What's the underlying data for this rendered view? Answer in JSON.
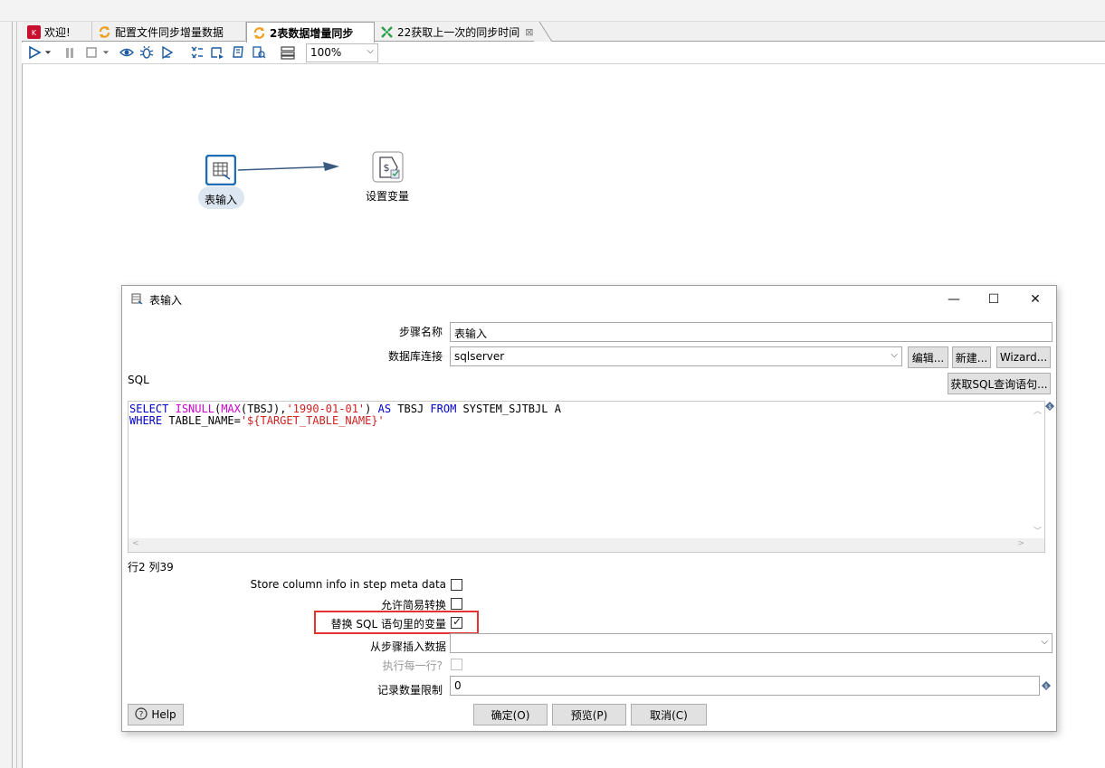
{
  "tabs": [
    {
      "label": "欢迎!",
      "icon": "kettle-icon"
    },
    {
      "label": "配置文件同步增量数据",
      "icon": "transformation-icon"
    },
    {
      "label": "2表数据增量同步",
      "icon": "transformation-icon",
      "active": true
    },
    {
      "label": "22获取上一次的同步时间",
      "icon": "job-icon",
      "closable": true
    }
  ],
  "toolbar": {
    "zoom_value": "100%"
  },
  "canvas": {
    "nodes": [
      {
        "label": "表输入",
        "icon": "table-input-icon",
        "selected": true
      },
      {
        "label": "设置变量",
        "icon": "set-variable-icon"
      }
    ]
  },
  "dialog": {
    "title": "表输入",
    "step_name_label": "步骤名称",
    "step_name_value": "表输入",
    "db_connection_label": "数据库连接",
    "db_connection_value": "sqlserver",
    "edit_button": "编辑...",
    "new_button": "新建...",
    "wizard_button": "Wizard...",
    "sql_label": "SQL",
    "get_sql_button": "获取SQL查询语句...",
    "sql_line1": {
      "t1": "SELECT",
      "t2": " ",
      "t3": "ISNULL",
      "t4": "(",
      "t5": "MAX",
      "t6": "(TBSJ),",
      "t7": "'1990-01-01'",
      "t8": ") ",
      "t9": "AS",
      "t10": " TBSJ ",
      "t11": "FROM",
      "t12": " SYSTEM_SJTBJL A"
    },
    "sql_line2": {
      "t1": "WHERE",
      "t2": " TABLE_NAME=",
      "t3": "'${TARGET_TABLE_NAME}'"
    },
    "cursor_position": "行2 列39",
    "store_column_info_label": "Store column info in step meta data",
    "store_column_info_checked": false,
    "lazy_conversion_label": "允许简易转换",
    "lazy_conversion_checked": false,
    "replace_variables_label": "替换 SQL 语句里的变量",
    "replace_variables_checked": true,
    "insert_from_step_label": "从步骤插入数据",
    "insert_from_step_value": "",
    "execute_each_row_label": "执行每一行?",
    "execute_each_row_checked": false,
    "limit_label": "记录数量限制",
    "limit_value": "0",
    "help_button": "Help",
    "ok_button": "确定(O)",
    "preview_button": "预览(P)",
    "cancel_button": "取消(C)"
  },
  "colors": {
    "keyword": "#0000cc",
    "function": "#cc00cc",
    "string": "#cc2222",
    "highlight": "#e53333",
    "node_selected_border": "#1f6db5"
  }
}
